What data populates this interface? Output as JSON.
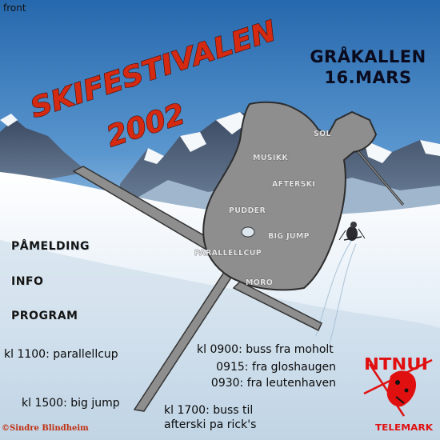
{
  "front_label": "front",
  "festival": {
    "title": "SKIFESTIVALEN",
    "year": "2002"
  },
  "venue": {
    "name": "GRÅKALLEN",
    "date": "16.MARS"
  },
  "map_labels": {
    "sol": "SOL",
    "musikk": "MUSIKK",
    "afterski": "AFTERSKI",
    "pudder": "PUDDER",
    "big_jump": "BIG JUMP",
    "parallellcup": "PARALLELLCUP",
    "moro": "MORO"
  },
  "nav": {
    "pamelding": "PÅMELDING",
    "info": "INFO",
    "program": "PROGRAM"
  },
  "schedule": {
    "parallellcup": "kl 1100: parallellcup",
    "buss_moholt": "kl 0900: buss fra moholt",
    "gloshaugen": "0915: fra gloshaugen",
    "leutenhaven": "0930: fra leutenhaven",
    "big_jump": "kl 1500: big jump",
    "buss_afterski_line1": "kl 1700: buss til",
    "buss_afterski_line2": "afterski pa rick's"
  },
  "logo": {
    "top": "NTNUI",
    "bottom": "TELEMARK"
  },
  "credit": "©Sindre Blindheim",
  "colors": {
    "title_red": "#d42a12",
    "logo_red": "#e01010",
    "map_fill": "#8e8e8e",
    "sky_top": "#2a70b4",
    "snow": "#e8f0f6"
  }
}
